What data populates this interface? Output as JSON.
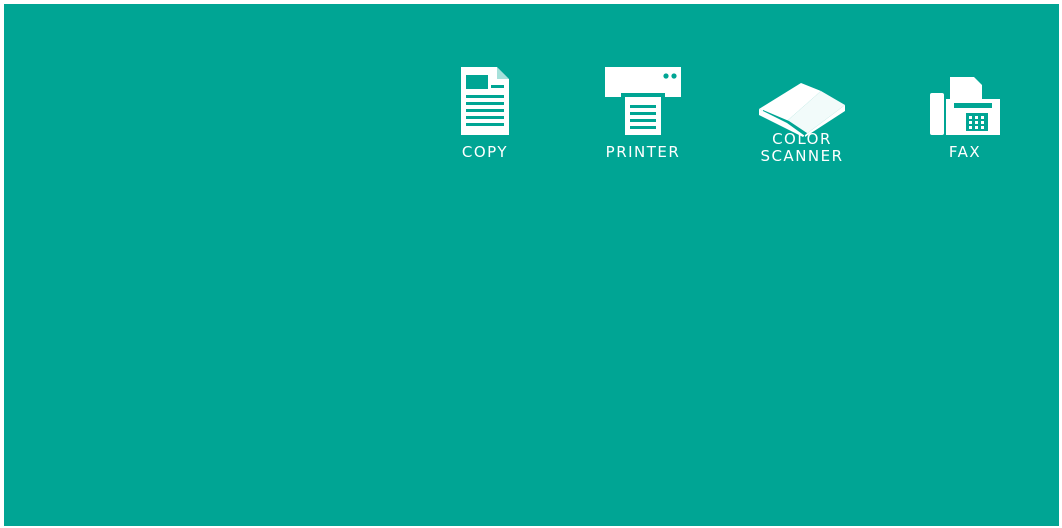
{
  "theme": {
    "background": "#00a594",
    "foreground": "#ffffff"
  },
  "features": [
    {
      "id": "copy",
      "icon": "document-icon",
      "label": "COPY"
    },
    {
      "id": "printer",
      "icon": "printer-icon",
      "label": "PRINTER"
    },
    {
      "id": "scanner",
      "icon": "flatbed-scanner-icon",
      "label_lines": [
        "COLOR",
        "SCANNER"
      ]
    },
    {
      "id": "fax",
      "icon": "fax-machine-icon",
      "label": "FAX"
    }
  ]
}
